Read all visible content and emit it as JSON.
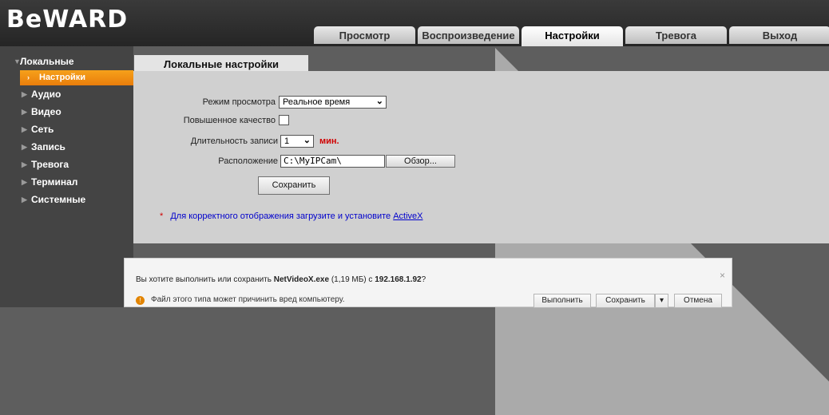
{
  "header": {
    "logo": "BeWARD",
    "tabs": [
      "Просмотр",
      "Воспроизведение",
      "Настройки",
      "Тревога",
      "Выход"
    ],
    "active_tab": "Настройки"
  },
  "sidebar": {
    "items": [
      {
        "label": "Локальные"
      },
      {
        "label": "Настройки"
      },
      {
        "label": "Аудио"
      },
      {
        "label": "Видео"
      },
      {
        "label": "Сеть"
      },
      {
        "label": "Запись"
      },
      {
        "label": "Тревога"
      },
      {
        "label": "Терминал"
      },
      {
        "label": "Системные"
      }
    ]
  },
  "content": {
    "tab_title": "Локальные настройки",
    "view_mode": {
      "label": "Режим просмотра",
      "value": "Реальное время"
    },
    "high_quality": {
      "label": "Повышенное качество",
      "checked": false
    },
    "record_duration": {
      "label": "Длительность записи",
      "value": "1",
      "unit": "мин."
    },
    "location": {
      "label": "Расположение",
      "value": "C:\\MyIPCam\\",
      "browse": "Обзор..."
    },
    "save": "Сохранить",
    "note_star": "*",
    "note_text": "Для корректного отображения загрузите и установите ",
    "note_link": "ActiveX"
  },
  "download_bar": {
    "prompt_start": "Вы хотите выполнить или сохранить ",
    "file_name": "NetVideoX.exe",
    "file_size": "(1,19 МБ)",
    "prompt_from": " с ",
    "host": "192.168.1.92",
    "prompt_end": "?",
    "warning": "Файл этого типа может причинить вред компьютеру.",
    "run": "Выполнить",
    "save": "Сохранить",
    "dropdown": "▾",
    "cancel": "Отмена",
    "close": "×"
  },
  "icons": {
    "arrow": "triangle-right-icon",
    "warning": "shield-warning-icon"
  },
  "colors": {
    "accent": "#f08a12",
    "link": "#0000cc",
    "unit": "#d00000"
  }
}
